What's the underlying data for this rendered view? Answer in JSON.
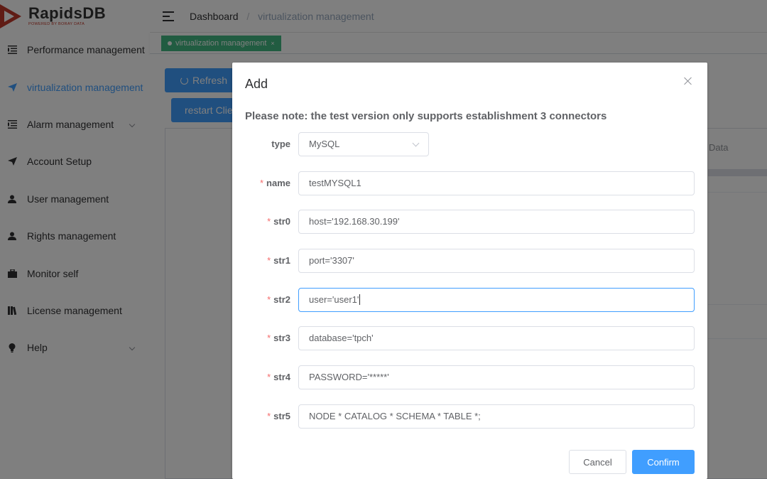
{
  "app": {
    "logo_title": "RapidsDB",
    "logo_subtitle": "POWERED BY BORAY DATA"
  },
  "sidebar": {
    "items": [
      {
        "label": "Performance management",
        "icon": "list-icon"
      },
      {
        "label": "virtualization management",
        "icon": "send-icon",
        "active": true
      },
      {
        "label": "Alarm management",
        "icon": "list-icon",
        "has_submenu": true
      },
      {
        "label": "Account Setup",
        "icon": "send-icon"
      },
      {
        "label": "User management",
        "icon": "user-icon"
      },
      {
        "label": "Rights management",
        "icon": "user-icon"
      },
      {
        "label": "Monitor self",
        "icon": "briefcase-icon"
      },
      {
        "label": "License management",
        "icon": "books-icon"
      },
      {
        "label": "Help",
        "icon": "bulb-icon",
        "has_submenu": true
      }
    ]
  },
  "header": {
    "breadcrumb_root": "Dashboard",
    "breadcrumb_sep": "/",
    "breadcrumb_current": "virtualization management"
  },
  "tags": {
    "active_tag": "virtualization management",
    "close": "×"
  },
  "main": {
    "refresh_label": "Refresh",
    "restart_label": "restart Clie",
    "column_header": "Data"
  },
  "dialog": {
    "title": "Add",
    "note": "Please note: the test version only supports establishment 3 connectors",
    "fields": {
      "type": {
        "label": "type",
        "value": "MySQL"
      },
      "name": {
        "label": "name",
        "value": "testMYSQL1"
      },
      "str0": {
        "label": "str0",
        "value": "host='192.168.30.199'"
      },
      "str1": {
        "label": "str1",
        "value": "port='3307'"
      },
      "str2": {
        "label": "str2",
        "value": "user='user1'"
      },
      "str3": {
        "label": "str3",
        "value": "database='tpch'"
      },
      "str4": {
        "label": "str4",
        "value": "PASSWORD='*****'"
      },
      "str5": {
        "label": "str5",
        "value": "NODE * CATALOG * SCHEMA * TABLE *;"
      }
    },
    "required_mark": "*",
    "cancel_label": "Cancel",
    "confirm_label": "Confirm"
  },
  "colors": {
    "primary": "#409eff",
    "tag_green": "#42b983",
    "required_red": "#f56c6c"
  }
}
